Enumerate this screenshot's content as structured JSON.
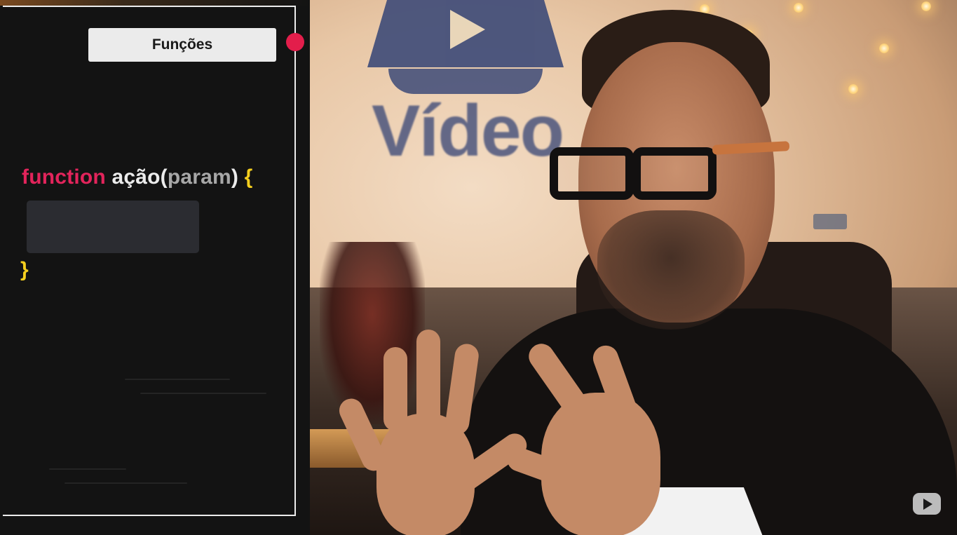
{
  "overlay": {
    "title": "Funções",
    "code": {
      "keyword": "function",
      "name": "ação",
      "open_paren": "(",
      "param": "param",
      "close_paren": ")",
      "open_brace": "{",
      "close_brace": "}"
    }
  },
  "background": {
    "logo_text": "Vídeo"
  },
  "icons": {
    "record": "record-dot-icon",
    "watermark": "youtube-play-icon"
  },
  "colors": {
    "keyword": "#e2245b",
    "brace": "#f5cf1e",
    "record": "#e31e4b"
  }
}
